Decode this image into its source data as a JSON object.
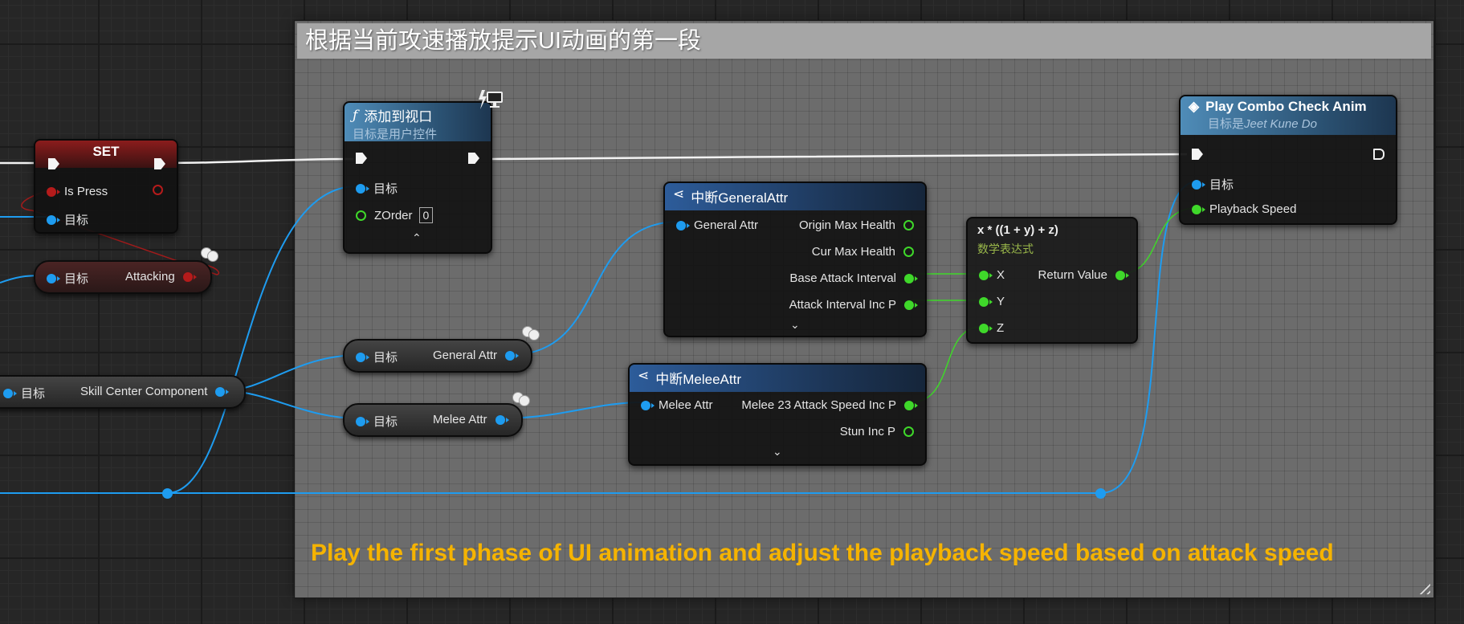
{
  "comment": {
    "title": "根据当前攻速播放提示UI动画的第一段",
    "note": "Play the first phase of UI animation and adjust the playback speed based on attack speed"
  },
  "set_node": {
    "title": "SET",
    "pin_is_press": "Is Press",
    "pin_target": "目标"
  },
  "attacking_getter": {
    "target": "目标",
    "value": "Attacking"
  },
  "skill_center_getter": {
    "target": "目标",
    "value": "Skill Center Component"
  },
  "add_to_viewport": {
    "title": "添加到视口",
    "subtitle": "目标是用户控件",
    "pin_target": "目标",
    "pin_zorder": "ZOrder",
    "zorder_value": "0",
    "func_glyph": "ƒ"
  },
  "general_attr_getter": {
    "target": "目标",
    "value": "General Attr"
  },
  "melee_attr_getter": {
    "target": "目标",
    "value": "Melee Attr"
  },
  "break_general": {
    "title": "中断GeneralAttr",
    "input": "General Attr",
    "outputs": [
      "Origin Max Health",
      "Cur Max Health",
      "Base Attack Interval",
      "Attack Interval Inc P"
    ]
  },
  "break_melee": {
    "title": "中断MeleeAttr",
    "input": "Melee Attr",
    "outputs": [
      "Melee 23 Attack Speed Inc P",
      "Stun Inc P"
    ]
  },
  "math_expr": {
    "title": "x * ((1 + y) + z)",
    "subtitle": "数学表达式",
    "inputs": [
      "X",
      "Y",
      "Z"
    ],
    "output": "Return Value"
  },
  "play_combo": {
    "title": "Play Combo Check Anim",
    "subtitle_prefix": "目标是",
    "subtitle_target": "Jeet Kune Do",
    "pin_target": "目标",
    "pin_speed": "Playback Speed"
  },
  "colors": {
    "object_pin": "#1e9cf0",
    "float_pin": "#3fd82a",
    "bool_pin": "#b51b1b",
    "exec_pin": "#f4f4f4",
    "note_text": "#f5b300"
  },
  "icons": [
    "function-icon",
    "network-monitor-icon",
    "event-diamond-icon",
    "break-struct-icon",
    "latent-clock-icon",
    "expand-chevron-icon",
    "resize-handle-icon"
  ]
}
